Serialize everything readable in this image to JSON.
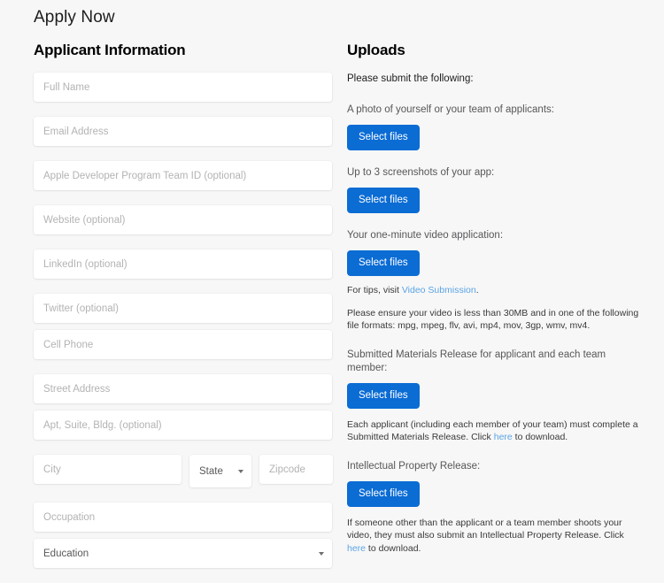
{
  "page": {
    "title": "Apply Now"
  },
  "applicant": {
    "heading": "Applicant Information",
    "fields": [
      {
        "name": "full-name",
        "placeholder": "Full Name",
        "type": "text"
      },
      {
        "name": "email-address",
        "placeholder": "Email Address",
        "type": "text"
      },
      {
        "name": "apple-team-id",
        "placeholder": "Apple Developer Program Team ID (optional)",
        "type": "text"
      },
      {
        "name": "website",
        "placeholder": "Website (optional)",
        "type": "text"
      },
      {
        "name": "linkedin",
        "placeholder": "LinkedIn (optional)",
        "type": "text"
      },
      {
        "name": "twitter",
        "placeholder": "Twitter (optional)",
        "type": "text"
      },
      {
        "name": "cell-phone",
        "placeholder": "Cell Phone",
        "type": "text"
      },
      {
        "name": "street-address",
        "placeholder": "Street Address",
        "type": "text"
      },
      {
        "name": "apt-suite-bldg",
        "placeholder": "Apt, Suite, Bldg. (optional)",
        "type": "text"
      }
    ],
    "city": {
      "placeholder": "City"
    },
    "state": {
      "value": "State"
    },
    "zipcode": {
      "placeholder": "Zipcode"
    },
    "occupation": {
      "placeholder": "Occupation"
    },
    "education": {
      "value": "Education"
    }
  },
  "uploads": {
    "heading": "Uploads",
    "intro": "Please submit the following:",
    "button_label": "Select files",
    "blocks": [
      {
        "name": "photo",
        "label": "A photo of yourself or your team of applicants:",
        "notes": []
      },
      {
        "name": "screenshots",
        "label": "Up to 3 screenshots of your app:",
        "notes": []
      },
      {
        "name": "video",
        "label": "Your one-minute video application:",
        "notes": [
          {
            "before": "For tips, visit ",
            "link": "Video Submission",
            "after": "."
          },
          {
            "before": "Please ensure your video is less than 30MB and in one of the following file formats: mpg, mpeg, flv, avi, mp4, mov, 3gp, wmv, mv4.",
            "link": "",
            "after": ""
          }
        ]
      },
      {
        "name": "submitted-materials-release",
        "label": "Submitted Materials Release for applicant and each team member:",
        "notes": [
          {
            "before": "Each applicant (including each member of your team) must complete a Submitted Materials Release. Click ",
            "link": "here",
            "after": " to download."
          }
        ]
      },
      {
        "name": "intellectual-property-release",
        "label": "Intellectual Property Release:",
        "notes": [
          {
            "before": "If someone other than the applicant or a team member shoots your video, they must also submit an Intellectual Property Release. Click ",
            "link": "here",
            "after": " to download."
          }
        ]
      }
    ]
  },
  "colors": {
    "background": "#f7f7f7",
    "field_background": "#ffffff",
    "button_blue": "#0b6cd4",
    "link_blue": "#5ba4e5",
    "placeholder_gray": "#b3b3b3",
    "label_gray": "#57575a"
  }
}
